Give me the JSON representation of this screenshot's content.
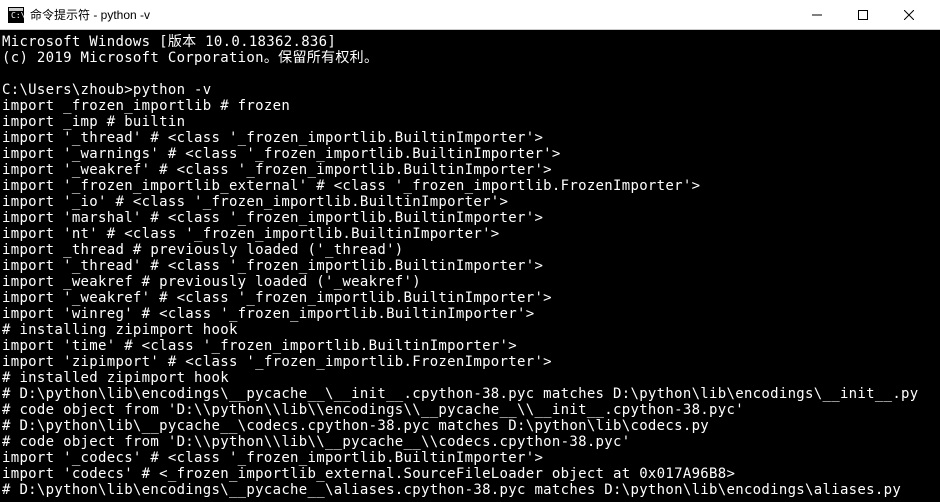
{
  "titlebar": {
    "title": "命令提示符 - python  -v"
  },
  "terminal": {
    "lines": [
      "Microsoft Windows [版本 10.0.18362.836]",
      "(c) 2019 Microsoft Corporation。保留所有权利。",
      "",
      "C:\\Users\\zhoub>python -v",
      "import _frozen_importlib # frozen",
      "import _imp # builtin",
      "import '_thread' # <class '_frozen_importlib.BuiltinImporter'>",
      "import '_warnings' # <class '_frozen_importlib.BuiltinImporter'>",
      "import '_weakref' # <class '_frozen_importlib.BuiltinImporter'>",
      "import '_frozen_importlib_external' # <class '_frozen_importlib.FrozenImporter'>",
      "import '_io' # <class '_frozen_importlib.BuiltinImporter'>",
      "import 'marshal' # <class '_frozen_importlib.BuiltinImporter'>",
      "import 'nt' # <class '_frozen_importlib.BuiltinImporter'>",
      "import _thread # previously loaded ('_thread')",
      "import '_thread' # <class '_frozen_importlib.BuiltinImporter'>",
      "import _weakref # previously loaded ('_weakref')",
      "import '_weakref' # <class '_frozen_importlib.BuiltinImporter'>",
      "import 'winreg' # <class '_frozen_importlib.BuiltinImporter'>",
      "# installing zipimport hook",
      "import 'time' # <class '_frozen_importlib.BuiltinImporter'>",
      "import 'zipimport' # <class '_frozen_importlib.FrozenImporter'>",
      "# installed zipimport hook",
      "# D:\\python\\lib\\encodings\\__pycache__\\__init__.cpython-38.pyc matches D:\\python\\lib\\encodings\\__init__.py",
      "# code object from 'D:\\\\python\\\\lib\\\\encodings\\\\__pycache__\\\\__init__.cpython-38.pyc'",
      "# D:\\python\\lib\\__pycache__\\codecs.cpython-38.pyc matches D:\\python\\lib\\codecs.py",
      "# code object from 'D:\\\\python\\\\lib\\\\__pycache__\\\\codecs.cpython-38.pyc'",
      "import '_codecs' # <class '_frozen_importlib.BuiltinImporter'>",
      "import 'codecs' # <_frozen_importlib_external.SourceFileLoader object at 0x017A96B8>",
      "# D:\\python\\lib\\encodings\\__pycache__\\aliases.cpython-38.pyc matches D:\\python\\lib\\encodings\\aliases.py"
    ]
  }
}
